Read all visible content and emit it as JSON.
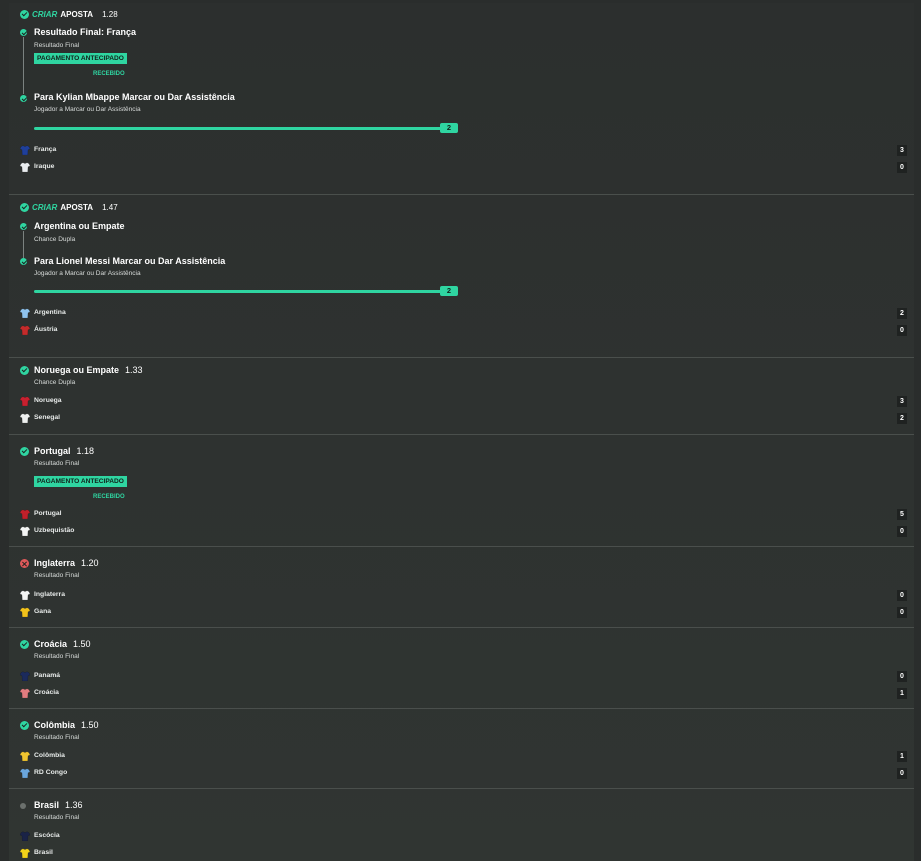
{
  "selections": [
    {
      "header": {
        "accent": "CRIAR",
        "label": "APOSTA",
        "odds": "1.28"
      },
      "legs": [
        {
          "title": "Resultado Final: França",
          "market": "Resultado Final"
        },
        {
          "title": "Para Kylian Mbappe Marcar ou Dar Assistência",
          "market": "Jogador a Marcar ou Dar Assistência"
        }
      ],
      "early_payout": {
        "badge": "PAGAMENTO ANTECIPADO",
        "status": "RECEBIDO"
      },
      "progress": {
        "value": "2",
        "fraction": 1.0
      },
      "teams": [
        {
          "name": "França",
          "score": "3",
          "shirt_color": "#1f3f9a"
        },
        {
          "name": "Iraque",
          "score": "0",
          "shirt_color": "#e9ecef"
        }
      ]
    },
    {
      "header": {
        "accent": "CRIAR",
        "label": "APOSTA",
        "odds": "1.47"
      },
      "legs": [
        {
          "title": "Argentina ou Empate",
          "market": "Chance Dupla"
        },
        {
          "title": "Para Lionel Messi Marcar ou Dar Assistência",
          "market": "Jogador a Marcar ou Dar Assistência"
        }
      ],
      "progress": {
        "value": "2",
        "fraction": 1.0
      },
      "teams": [
        {
          "name": "Argentina",
          "score": "2",
          "shirt_color": "#8fc3ee"
        },
        {
          "name": "Áustria",
          "score": "0",
          "shirt_color": "#c42b2b"
        }
      ]
    },
    {
      "status": "won",
      "title": "Noruega ou Empate",
      "odds": "1.33",
      "market": "Chance Dupla",
      "teams": [
        {
          "name": "Noruega",
          "score": "3",
          "shirt_color": "#c8202f"
        },
        {
          "name": "Senegal",
          "score": "2",
          "shirt_color": "#eef0ef"
        }
      ]
    },
    {
      "status": "won",
      "title": "Portugal",
      "odds": "1.18",
      "market": "Resultado Final",
      "early_payout": {
        "badge": "PAGAMENTO ANTECIPADO",
        "status": "RECEBIDO"
      },
      "teams": [
        {
          "name": "Portugal",
          "score": "5",
          "shirt_color": "#c0202a"
        },
        {
          "name": "Uzbequistão",
          "score": "0",
          "shirt_color": "#f4f5f4"
        }
      ]
    },
    {
      "status": "lost",
      "title": "Inglaterra",
      "odds": "1.20",
      "market": "Resultado Final",
      "teams": [
        {
          "name": "Inglaterra",
          "score": "0",
          "shirt_color": "#f4f5f4"
        },
        {
          "name": "Gana",
          "score": "0",
          "shirt_color": "#f2c21b"
        }
      ]
    },
    {
      "status": "won",
      "title": "Croácia",
      "odds": "1.50",
      "market": "Resultado Final",
      "teams": [
        {
          "name": "Panamá",
          "score": "0",
          "shirt_color": "#1b2a5c"
        },
        {
          "name": "Croácia",
          "score": "1",
          "shirt_color": "#e27d80"
        }
      ]
    },
    {
      "status": "won",
      "title": "Colômbia",
      "odds": "1.50",
      "market": "Resultado Final",
      "teams": [
        {
          "name": "Colômbia",
          "score": "1",
          "shirt_color": "#f1c530"
        },
        {
          "name": "RD Congo",
          "score": "0",
          "shirt_color": "#6aa6dc"
        }
      ]
    },
    {
      "status": "pending",
      "title": "Brasil",
      "odds": "1.36",
      "market": "Resultado Final",
      "teams": [
        {
          "name": "Escócia",
          "score": "",
          "shirt_color": "#1a2347"
        },
        {
          "name": "Brasil",
          "score": "",
          "shirt_color": "#f2d21a"
        }
      ]
    }
  ]
}
